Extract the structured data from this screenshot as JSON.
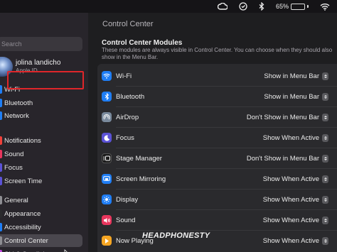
{
  "menubar": {
    "icons": [
      "creative-cloud-icon",
      "shield-icon",
      "bluetooth-icon",
      "wifi-icon"
    ],
    "battery_percent": "65%",
    "battery_level": 0.65
  },
  "sidebar": {
    "search_placeholder": "Search",
    "profile": {
      "name": "jolina landicho",
      "subtitle": "Apple ID"
    },
    "items": [
      {
        "label": "Wi-Fi",
        "color": "#1f7ef5"
      },
      {
        "label": "Bluetooth",
        "color": "#1f7ef5"
      },
      {
        "label": "Network",
        "color": "#1f7ef5"
      },
      {
        "label": "Notifications",
        "color": "#f0413b"
      },
      {
        "label": "Sound",
        "color": "#e8365d"
      },
      {
        "label": "Focus",
        "color": "#5b52d6"
      },
      {
        "label": "Screen Time",
        "color": "#5b52d6"
      },
      {
        "label": "General",
        "color": "#8e8e93"
      },
      {
        "label": "Appearance",
        "color": "#2a2a2d"
      },
      {
        "label": "Accessibility",
        "color": "#1f7ef5"
      },
      {
        "label": "Control Center",
        "color": "#8e8e93",
        "active": true
      },
      {
        "label": "Siri & Spotlight",
        "color": "#c44de0"
      }
    ]
  },
  "content": {
    "title": "Control Center",
    "section_title": "Control Center Modules",
    "section_desc": "These modules are always visible in Control Center. You can choose when they should also show in the Menu Bar.",
    "modules": [
      {
        "label": "Wi-Fi",
        "value": "Show in Menu Bar",
        "icon": "wifi-icon",
        "color": "#1f7ef5"
      },
      {
        "label": "Bluetooth",
        "value": "Show in Menu Bar",
        "icon": "bluetooth-icon",
        "color": "#1f7ef5"
      },
      {
        "label": "AirDrop",
        "value": "Don't Show in Menu Bar",
        "icon": "airdrop-icon",
        "color": "#7a8a9c"
      },
      {
        "label": "Focus",
        "value": "Show When Active",
        "icon": "moon-icon",
        "color": "#5b52d6"
      },
      {
        "label": "Stage Manager",
        "value": "Don't Show in Menu Bar",
        "icon": "stage-manager-icon",
        "color": "#1a1a1a"
      },
      {
        "label": "Screen Mirroring",
        "value": "Show When Active",
        "icon": "screen-mirroring-icon",
        "color": "#1f7ef5"
      },
      {
        "label": "Display",
        "value": "Show When Active",
        "icon": "sun-icon",
        "color": "#1f7ef5"
      },
      {
        "label": "Sound",
        "value": "Show When Active",
        "icon": "speaker-icon",
        "color": "#e8365d"
      },
      {
        "label": "Now Playing",
        "value": "Show When Active",
        "icon": "play-icon",
        "color": "#f5a623"
      }
    ]
  },
  "watermark": "HEADPHONESTY",
  "highlight_color": "#e0262a"
}
